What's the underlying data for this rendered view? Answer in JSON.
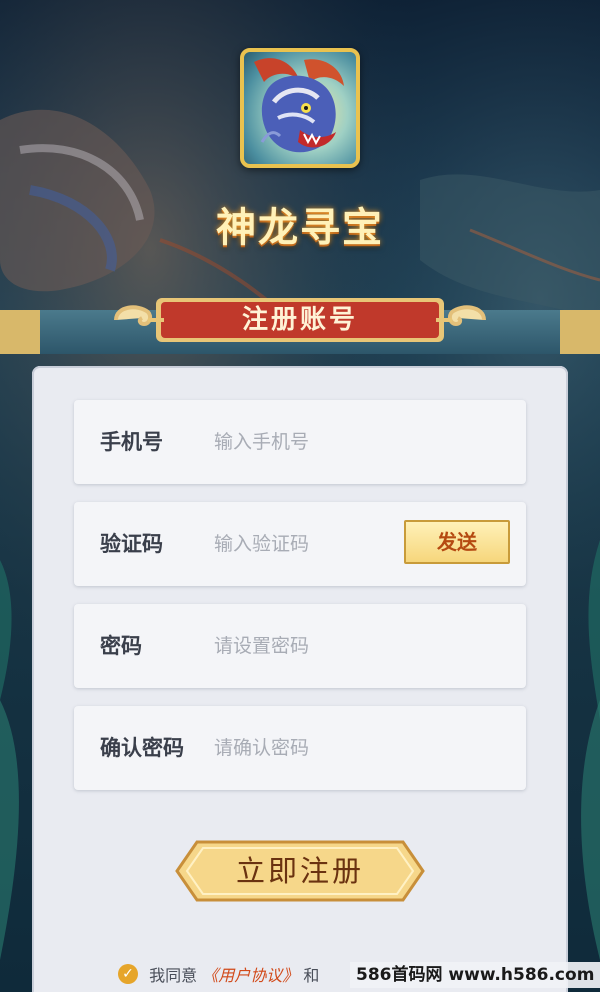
{
  "header": {
    "game_title": "神龙寻宝",
    "logo_icon": "dragon-logo-icon"
  },
  "register_tab": {
    "label": "注册账号"
  },
  "form": {
    "phone": {
      "label": "手机号",
      "placeholder": "输入手机号",
      "value": ""
    },
    "code": {
      "label": "验证码",
      "placeholder": "输入验证码",
      "value": "",
      "send_label": "发送"
    },
    "password": {
      "label": "密码",
      "placeholder": "请设置密码",
      "value": ""
    },
    "confirm": {
      "label": "确认密码",
      "placeholder": "请确认密码",
      "value": ""
    },
    "submit_label": "立即注册"
  },
  "agreement": {
    "prefix": "我同意",
    "user_agreement": "《用户协议》",
    "conjunction": "和"
  },
  "watermark": "586首码网 www.h586.com",
  "colors": {
    "accent_gold": "#e9c24f",
    "ribbon_red": "#c0392b",
    "link_red": "#d24a1a",
    "panel_bg": "#e9ebf1"
  }
}
